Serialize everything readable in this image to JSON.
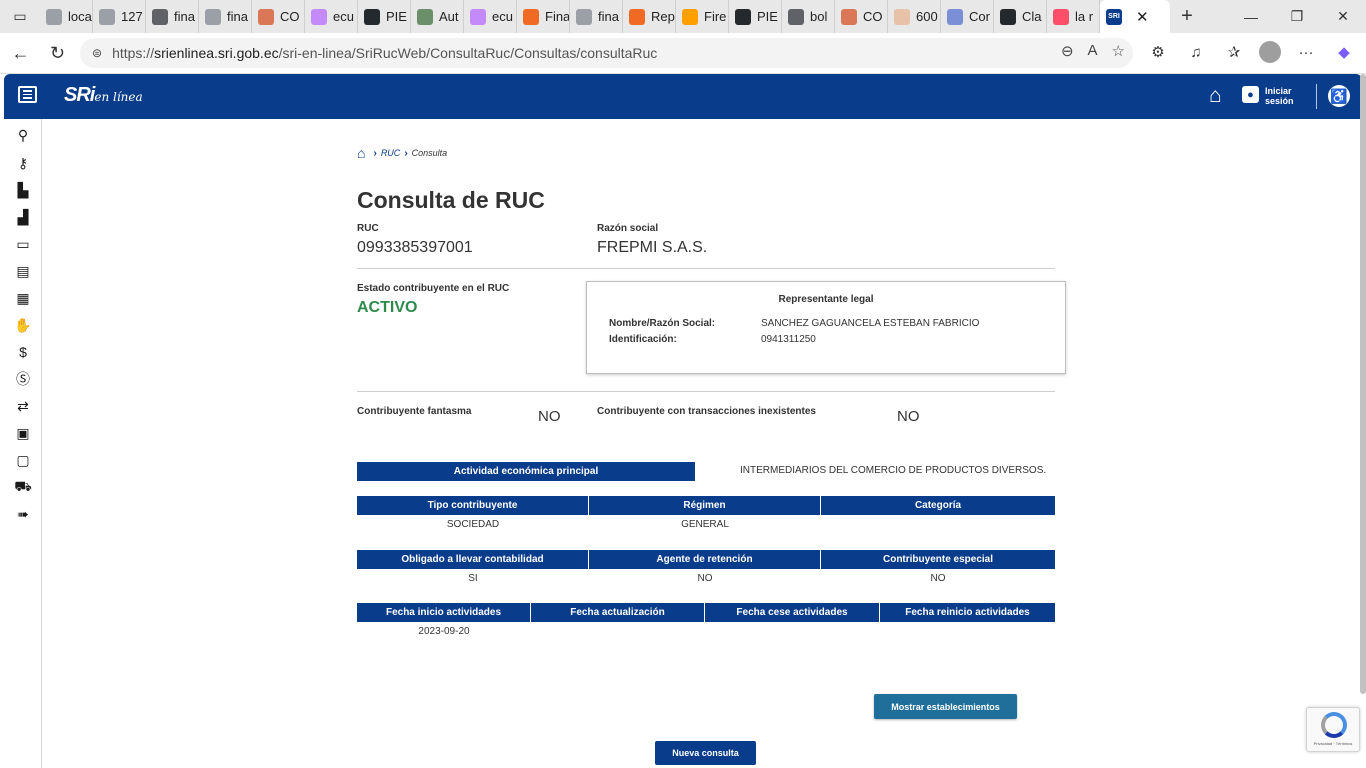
{
  "browser": {
    "tabs": [
      {
        "label": "loca",
        "color": "#9aa0a6"
      },
      {
        "label": "127",
        "color": "#9aa0a6"
      },
      {
        "label": "fina",
        "color": "#5f6368"
      },
      {
        "label": "fina",
        "color": "#9aa0a6"
      },
      {
        "label": "CO",
        "color": "#d97757"
      },
      {
        "label": "ecu",
        "color": "#c58af9"
      },
      {
        "label": "PIE",
        "color": "#24292e"
      },
      {
        "label": "Aut",
        "color": "#6b8e6b"
      },
      {
        "label": "ecu",
        "color": "#c58af9"
      },
      {
        "label": "Fina",
        "color": "#f06a24"
      },
      {
        "label": "fina",
        "color": "#9aa0a6"
      },
      {
        "label": "Rep",
        "color": "#f06a24"
      },
      {
        "label": "Fire",
        "color": "#ffa000"
      },
      {
        "label": "PIE",
        "color": "#24292e"
      },
      {
        "label": "bol",
        "color": "#5f6368"
      },
      {
        "label": "CO",
        "color": "#d97757"
      },
      {
        "label": "600",
        "color": "#e8c2a8"
      },
      {
        "label": "Cor",
        "color": "#7b8fd6"
      },
      {
        "label": "Cla",
        "color": "#24292e"
      },
      {
        "label": "la r",
        "color": "#ff4e6a"
      }
    ],
    "active_tab": {
      "favicon_text": "SRI",
      "close": "✕"
    },
    "new_tab": "+",
    "url_prefix": "https://",
    "url_host": "srienlinea.sri.gob.ec",
    "url_path": "/sri-en-linea/SriRucWeb/ConsultaRuc/Consultas/consultaRuc"
  },
  "header": {
    "logo": "SRi",
    "logo_suffix": "en línea",
    "login_label": "Iniciar sesión"
  },
  "breadcrumb": {
    "ruc": "RUC",
    "current": "Consulta"
  },
  "page": {
    "title": "Consulta de RUC",
    "ruc_label": "RUC",
    "ruc_value": "0993385397001",
    "razon_label": "Razón social",
    "razon_value": "FREPMI S.A.S.",
    "estado_label": "Estado contribuyente en el RUC",
    "estado_value": "ACTIVO",
    "representante": {
      "title": "Representante legal",
      "nombre_label": "Nombre/Razón Social:",
      "nombre_value": "SANCHEZ GAGUANCELA ESTEBAN FABRICIO",
      "id_label": "Identificación:",
      "id_value": "0941311250"
    },
    "fantasma_label": "Contribuyente fantasma",
    "fantasma_value": "NO",
    "inexistentes_label": "Contribuyente con transacciones inexistentes",
    "inexistentes_value": "NO",
    "actividad_label": "Actividad económica principal",
    "actividad_value": "INTERMEDIARIOS DEL COMERCIO DE PRODUCTOS DIVERSOS.",
    "table1": {
      "headers": [
        "Tipo contribuyente",
        "Régimen",
        "Categoría"
      ],
      "values": [
        "SOCIEDAD",
        "GENERAL",
        ""
      ]
    },
    "table2": {
      "headers": [
        "Obligado a llevar contabilidad",
        "Agente de retención",
        "Contribuyente especial"
      ],
      "values": [
        "SI",
        "NO",
        "NO"
      ]
    },
    "table3": {
      "headers": [
        "Fecha inicio actividades",
        "Fecha actualización",
        "Fecha cese actividades",
        "Fecha reinicio actividades"
      ],
      "values": [
        "2023-09-20",
        "",
        "",
        ""
      ]
    },
    "btn_establecimientos": "Mostrar establecimientos",
    "btn_nueva": "Nueva consulta",
    "recaptcha_text": "Privacidad · Términos"
  }
}
